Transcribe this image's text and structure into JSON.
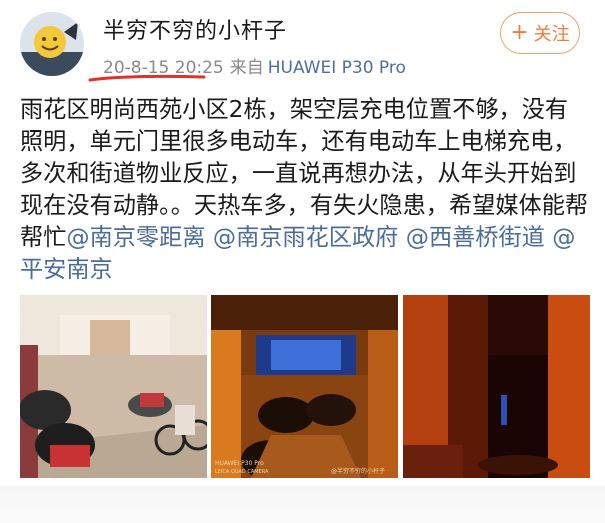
{
  "post": {
    "username": "半穷不穷的小杆子",
    "date": "20-8-15 20:25",
    "source_prefix": "来自",
    "device": "HUAWEI P30 Pro",
    "follow_label": "关注",
    "follow_plus": "+",
    "text": "雨花区明尚西苑小区2栋，架空层充电位置不够，没有照明，单元门里很多电动车，还有电动车上电梯充电，多次和街道物业反应，一直说再想办法，从年头开始到现在没有动静。。天热车多，有失火隐患，希望媒体能帮帮忙",
    "mentions": [
      "@南京零距离",
      "@南京雨花区政府",
      "@西善桥街道",
      "@平安南京"
    ],
    "photo2_watermark_model": "HUAWEI P30 Pro",
    "photo2_watermark_camera": "LEICA QUAD CAMERA",
    "photo2_watermark_user": "@半穷不穷的小杆子"
  },
  "colors": {
    "link": "#4a6d9a",
    "follow": "#ee7d3a",
    "underline": "#e0322a"
  }
}
